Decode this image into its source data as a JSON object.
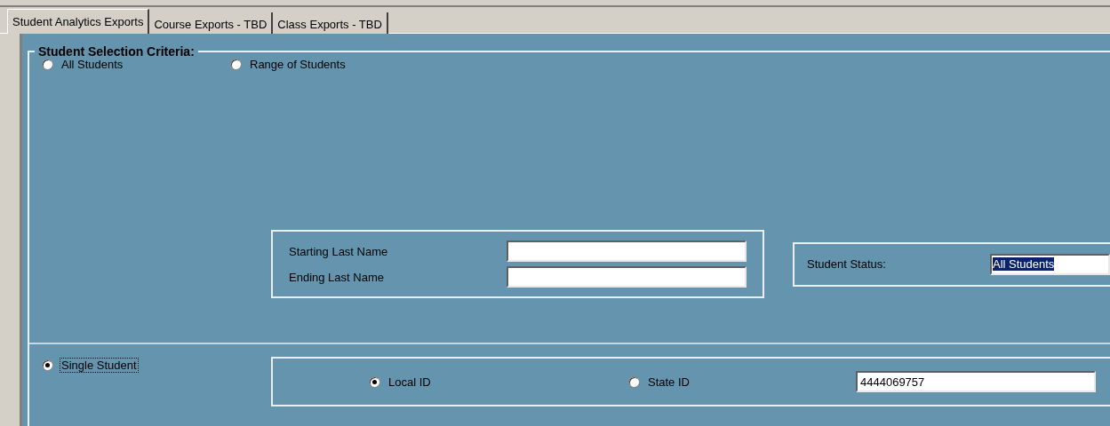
{
  "tabs": [
    {
      "label": "Student Analytics Exports",
      "selected": true
    },
    {
      "label": "Course Exports - TBD",
      "selected": false
    },
    {
      "label": "Class Exports - TBD",
      "selected": false
    }
  ],
  "criteria": {
    "title": "Student Selection Criteria:",
    "options": [
      {
        "label": "All Students",
        "selected": false,
        "focused": false
      },
      {
        "label": "Range of Students",
        "selected": false,
        "focused": false
      },
      {
        "label": "Single Student",
        "selected": true,
        "focused": true
      }
    ],
    "range_fields": [
      {
        "label": "Starting Last Name"
      },
      {
        "label": "Ending Last Name"
      }
    ],
    "status": {
      "label": "Student Status:",
      "value": "All Students",
      "text_selected": true
    },
    "id_types": [
      {
        "label": "Local ID",
        "selected": true
      },
      {
        "label": "State ID",
        "selected": false
      }
    ],
    "id_value": "4444069757"
  }
}
